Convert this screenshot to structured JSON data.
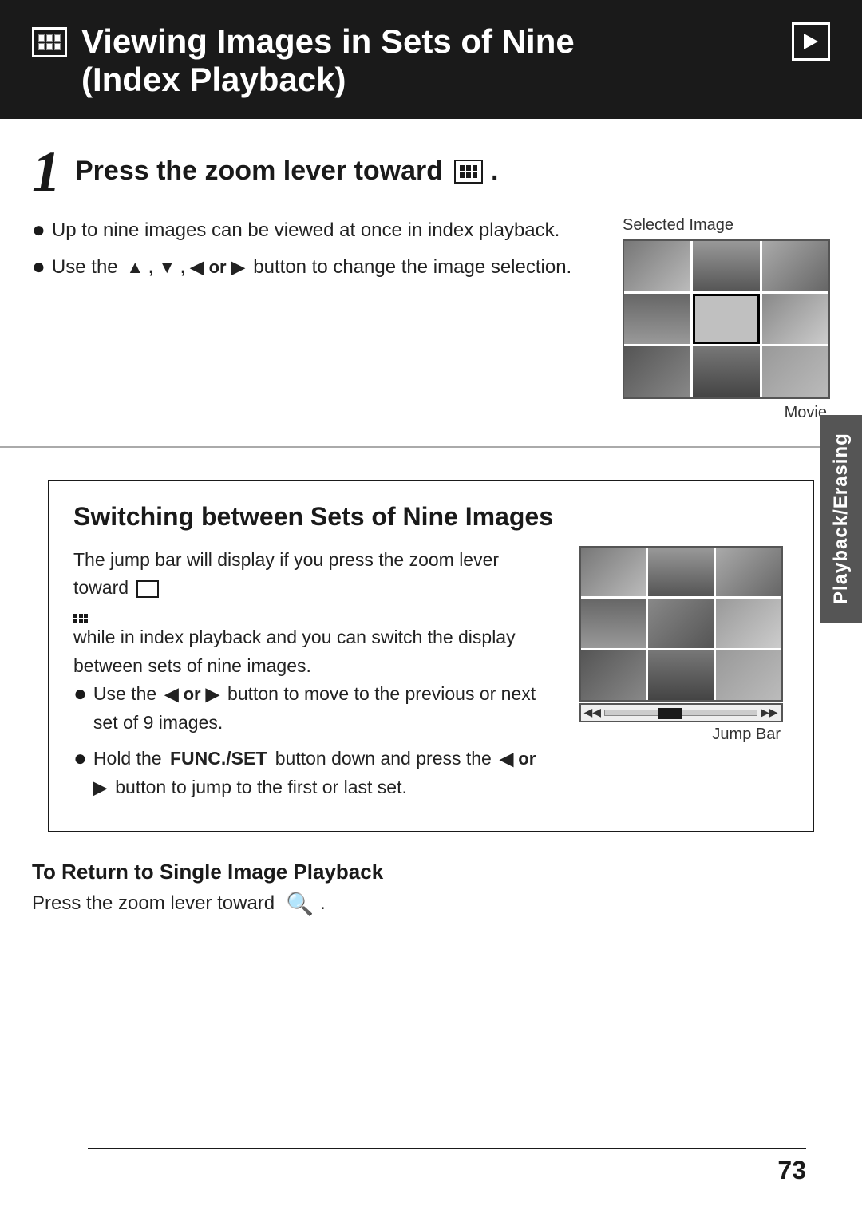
{
  "header": {
    "title_line1": "Viewing Images in Sets of Nine",
    "title_line2": "(Index Playback)",
    "icon_label": "index-icon",
    "playback_icon_label": "playback-icon"
  },
  "step1": {
    "number": "1",
    "title_prefix": "Press the zoom lever toward",
    "bullet1": "Up to nine images can be viewed at once in index playback.",
    "bullet2_prefix": "Use the",
    "bullet2_arrows": "▲ , ▼ , ◀ or ▶",
    "bullet2_suffix": "button to change the image selection.",
    "selected_image_label": "Selected Image",
    "movie_label": "Movie"
  },
  "switching": {
    "title": "Switching between Sets of Nine Images",
    "intro": "The jump bar will display if you press the zoom lever toward",
    "intro_suffix": "while in index playback and you can switch the display between sets of nine images.",
    "bullet1_prefix": "Use the",
    "bullet1_arrows": "◀ or ▶",
    "bullet1_suffix": "button to move to the previous or next set of 9 images.",
    "bullet2_prefix": "Hold the",
    "bullet2_bold": "FUNC./SET",
    "bullet2_mid": "button down and press the",
    "bullet2_arrows2": "◀ or ▶",
    "bullet2_suffix": "button to jump to the first or last set.",
    "jump_bar_label": "Jump Bar"
  },
  "return_section": {
    "title": "To Return to Single Image Playback",
    "text_prefix": "Press the zoom lever toward",
    "zoom_symbol": "🔍"
  },
  "side_tab": {
    "label": "Playback/Erasing"
  },
  "page": {
    "number": "73"
  }
}
